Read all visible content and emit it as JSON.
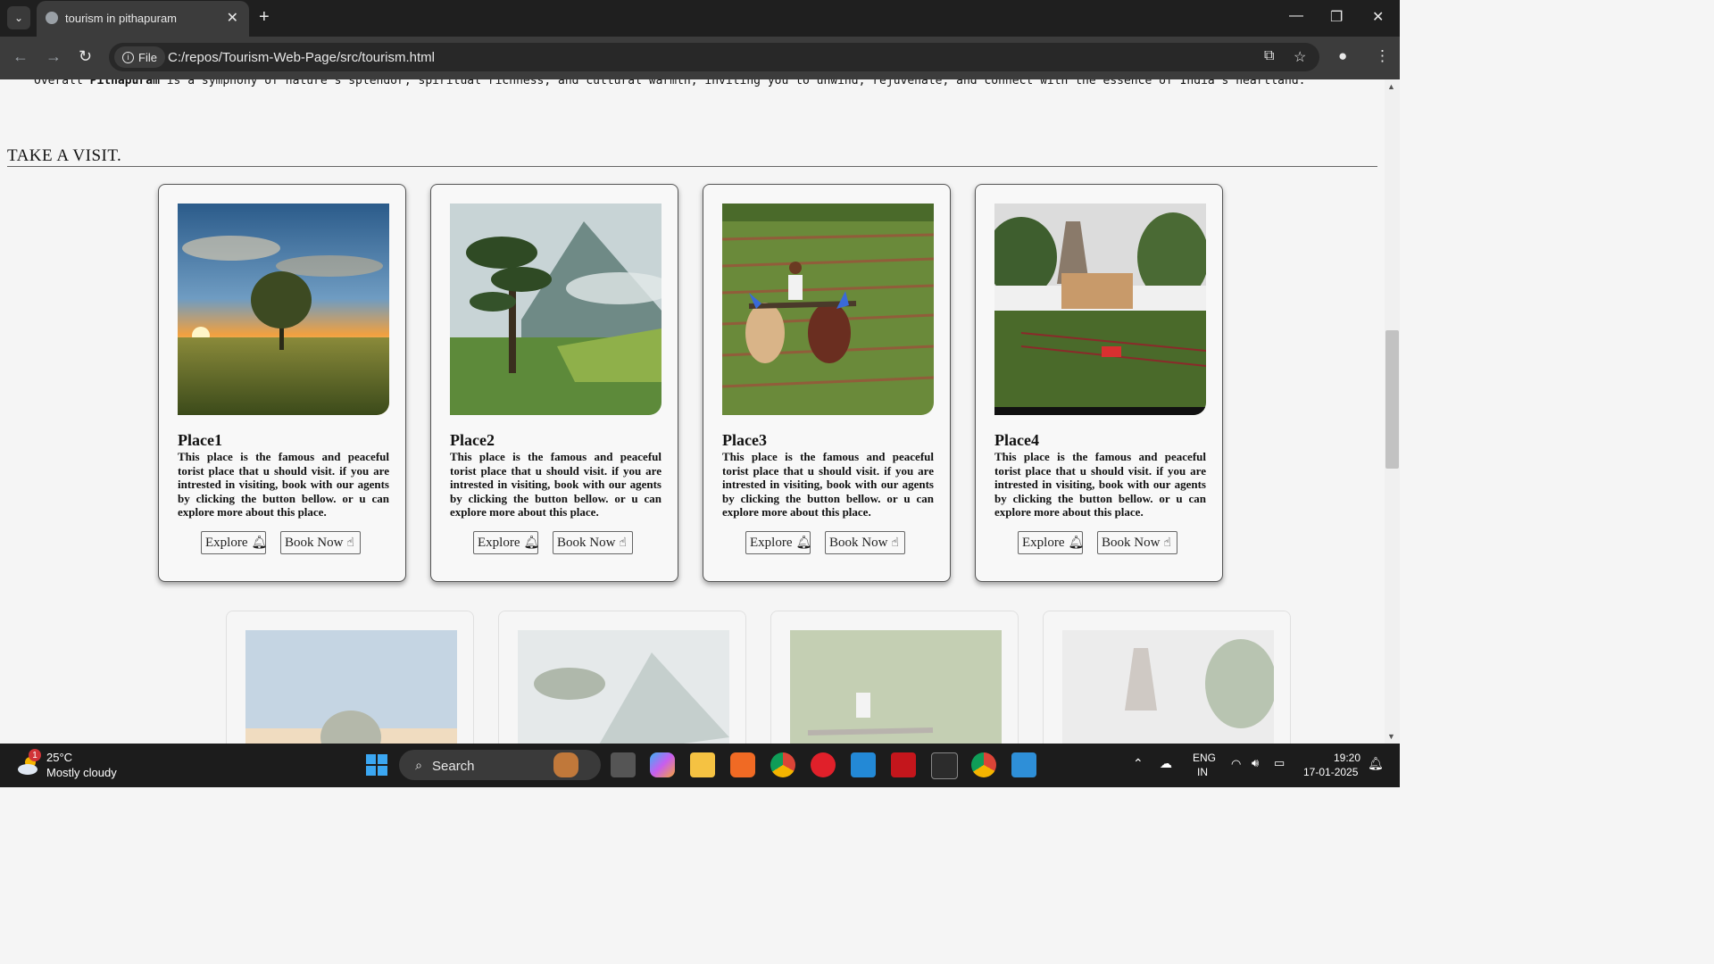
{
  "browser": {
    "tab_title": "tourism in pithapuram",
    "chip_label": "File",
    "url": "C:/repos/Tourism-Web-Page/src/tourism.html"
  },
  "page": {
    "intro_prefix": "Overall ",
    "intro_bold": "Pithapuram",
    "intro_suffix": " is a symphony of nature's splendor, spiritual richness, and cultural warmth, inviting you to unwind, rejuvenate, and connect with the essence of India's heartland.",
    "section_title": "TAKE A VISIT.",
    "cards": [
      {
        "name": "Place1",
        "desc": "This place is the famous and peaceful torist place that u should visit. if you are intrested in visiting, book with our agents by clicking the button bellow. or u can explore more about this place.",
        "explore": "Explore",
        "book": "Book Now"
      },
      {
        "name": "Place2",
        "desc": "This place is the famous and peaceful torist place that u should visit. if you are intrested in visiting, book with our agents by clicking the button bellow. or u can explore more about this place.",
        "explore": "Explore",
        "book": "Book Now"
      },
      {
        "name": "Place3",
        "desc": "This place is the famous and peaceful torist place that u should visit. if you are intrested in visiting, book with our agents by clicking the button bellow. or u can explore more about this place.",
        "explore": "Explore",
        "book": "Book Now"
      },
      {
        "name": "Place4",
        "desc": "This place is the famous and peaceful torist place that u should visit. if you are intrested in visiting, book with our agents by clicking the button bellow. or u can explore more about this place.",
        "explore": "Explore",
        "book": "Book Now"
      }
    ]
  },
  "taskbar": {
    "weather_temp": "25°C",
    "weather_desc": "Mostly cloudy",
    "weather_badge": "1",
    "search_label": "Search",
    "lang_top": "ENG",
    "lang_bottom": "IN",
    "time": "19:20",
    "date": "17-01-2025"
  }
}
